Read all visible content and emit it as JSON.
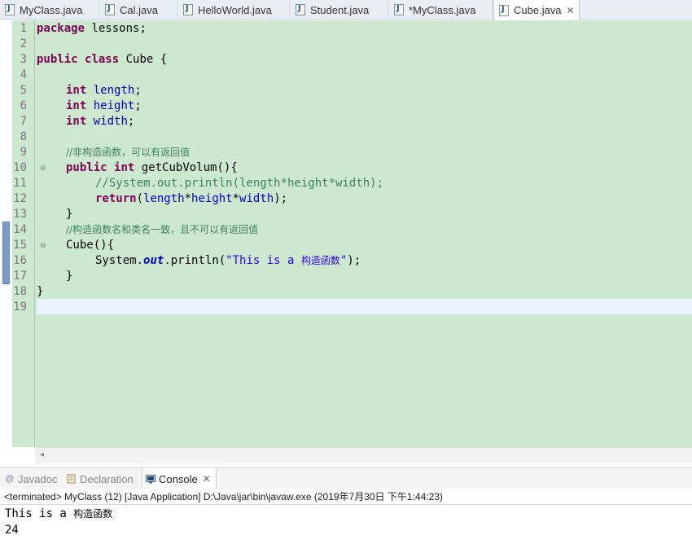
{
  "tabs": [
    {
      "label": "MyClass.java",
      "icon": "java-file-icon"
    },
    {
      "label": "Cal.java",
      "icon": "java-file-icon"
    },
    {
      "label": "HelloWorld.java",
      "icon": "java-file-icon"
    },
    {
      "label": "Student.java",
      "icon": "java-file-icon"
    },
    {
      "label": "*MyClass.java",
      "icon": "java-file-icon"
    },
    {
      "label": "Cube.java",
      "icon": "java-file-icon",
      "active": true,
      "close": "✕"
    }
  ],
  "editor": {
    "line_numbers": [
      "1",
      "2",
      "3",
      "4",
      "5",
      "6",
      "7",
      "8",
      "9",
      "10",
      "11",
      "12",
      "13",
      "14",
      "15",
      "16",
      "17",
      "18",
      "19"
    ],
    "code": {
      "l1_kw": "package",
      "l1_rest": " lessons;",
      "l3_kw1": "public",
      "l3_kw2": "class",
      "l3_rest": " Cube {",
      "l5_kw": "int",
      "l5_fld": "length",
      "l5_end": ";",
      "l6_kw": "int",
      "l6_fld": "height",
      "l6_end": ";",
      "l7_kw": "int",
      "l7_fld": "width",
      "l7_end": ";",
      "l9_cmt": "//非构造函数，可以有返回值",
      "l10_kw1": "public",
      "l10_kw2": "int",
      "l10_rest": " getCubVolum(){",
      "l11_cmt": "//System.out.println(length*height*width);",
      "l12_kw": "return",
      "l12_p1": "(",
      "l12_f1": "length",
      "l12_op1": "*",
      "l12_f2": "height",
      "l12_op2": "*",
      "l12_f3": "width",
      "l12_end": ");",
      "l13": "}",
      "l14_cmt": "//构造函数名和类名一致，且不可以有返回值",
      "l15": "Cube(){",
      "l16_a": "System.",
      "l16_out": "out",
      "l16_b": ".println(",
      "l16_str": "\"This is a ",
      "l16_strcn": "构造函数",
      "l16_strend": "\"",
      "l16_end": ");",
      "l17": "}",
      "l18": "}"
    }
  },
  "panel": {
    "tabs": [
      {
        "label": "Javadoc",
        "icon": "at-icon"
      },
      {
        "label": "Declaration",
        "icon": "declaration-icon"
      },
      {
        "label": "Console",
        "icon": "console-icon",
        "active": true,
        "close": "✕"
      }
    ],
    "status": "<terminated> MyClass (12) [Java Application] D:\\Java\\jar\\bin\\javaw.exe (2019年7月30日 下午1:44:23)",
    "output_l1": "This is a ",
    "output_l1_cn": "构造函数",
    "output_l2": "24"
  },
  "colors": {
    "editor_bg": "#cce8cf",
    "keyword": "#7f0055",
    "field": "#0000c0",
    "comment": "#3f7f5f",
    "string": "#2a00ff"
  }
}
